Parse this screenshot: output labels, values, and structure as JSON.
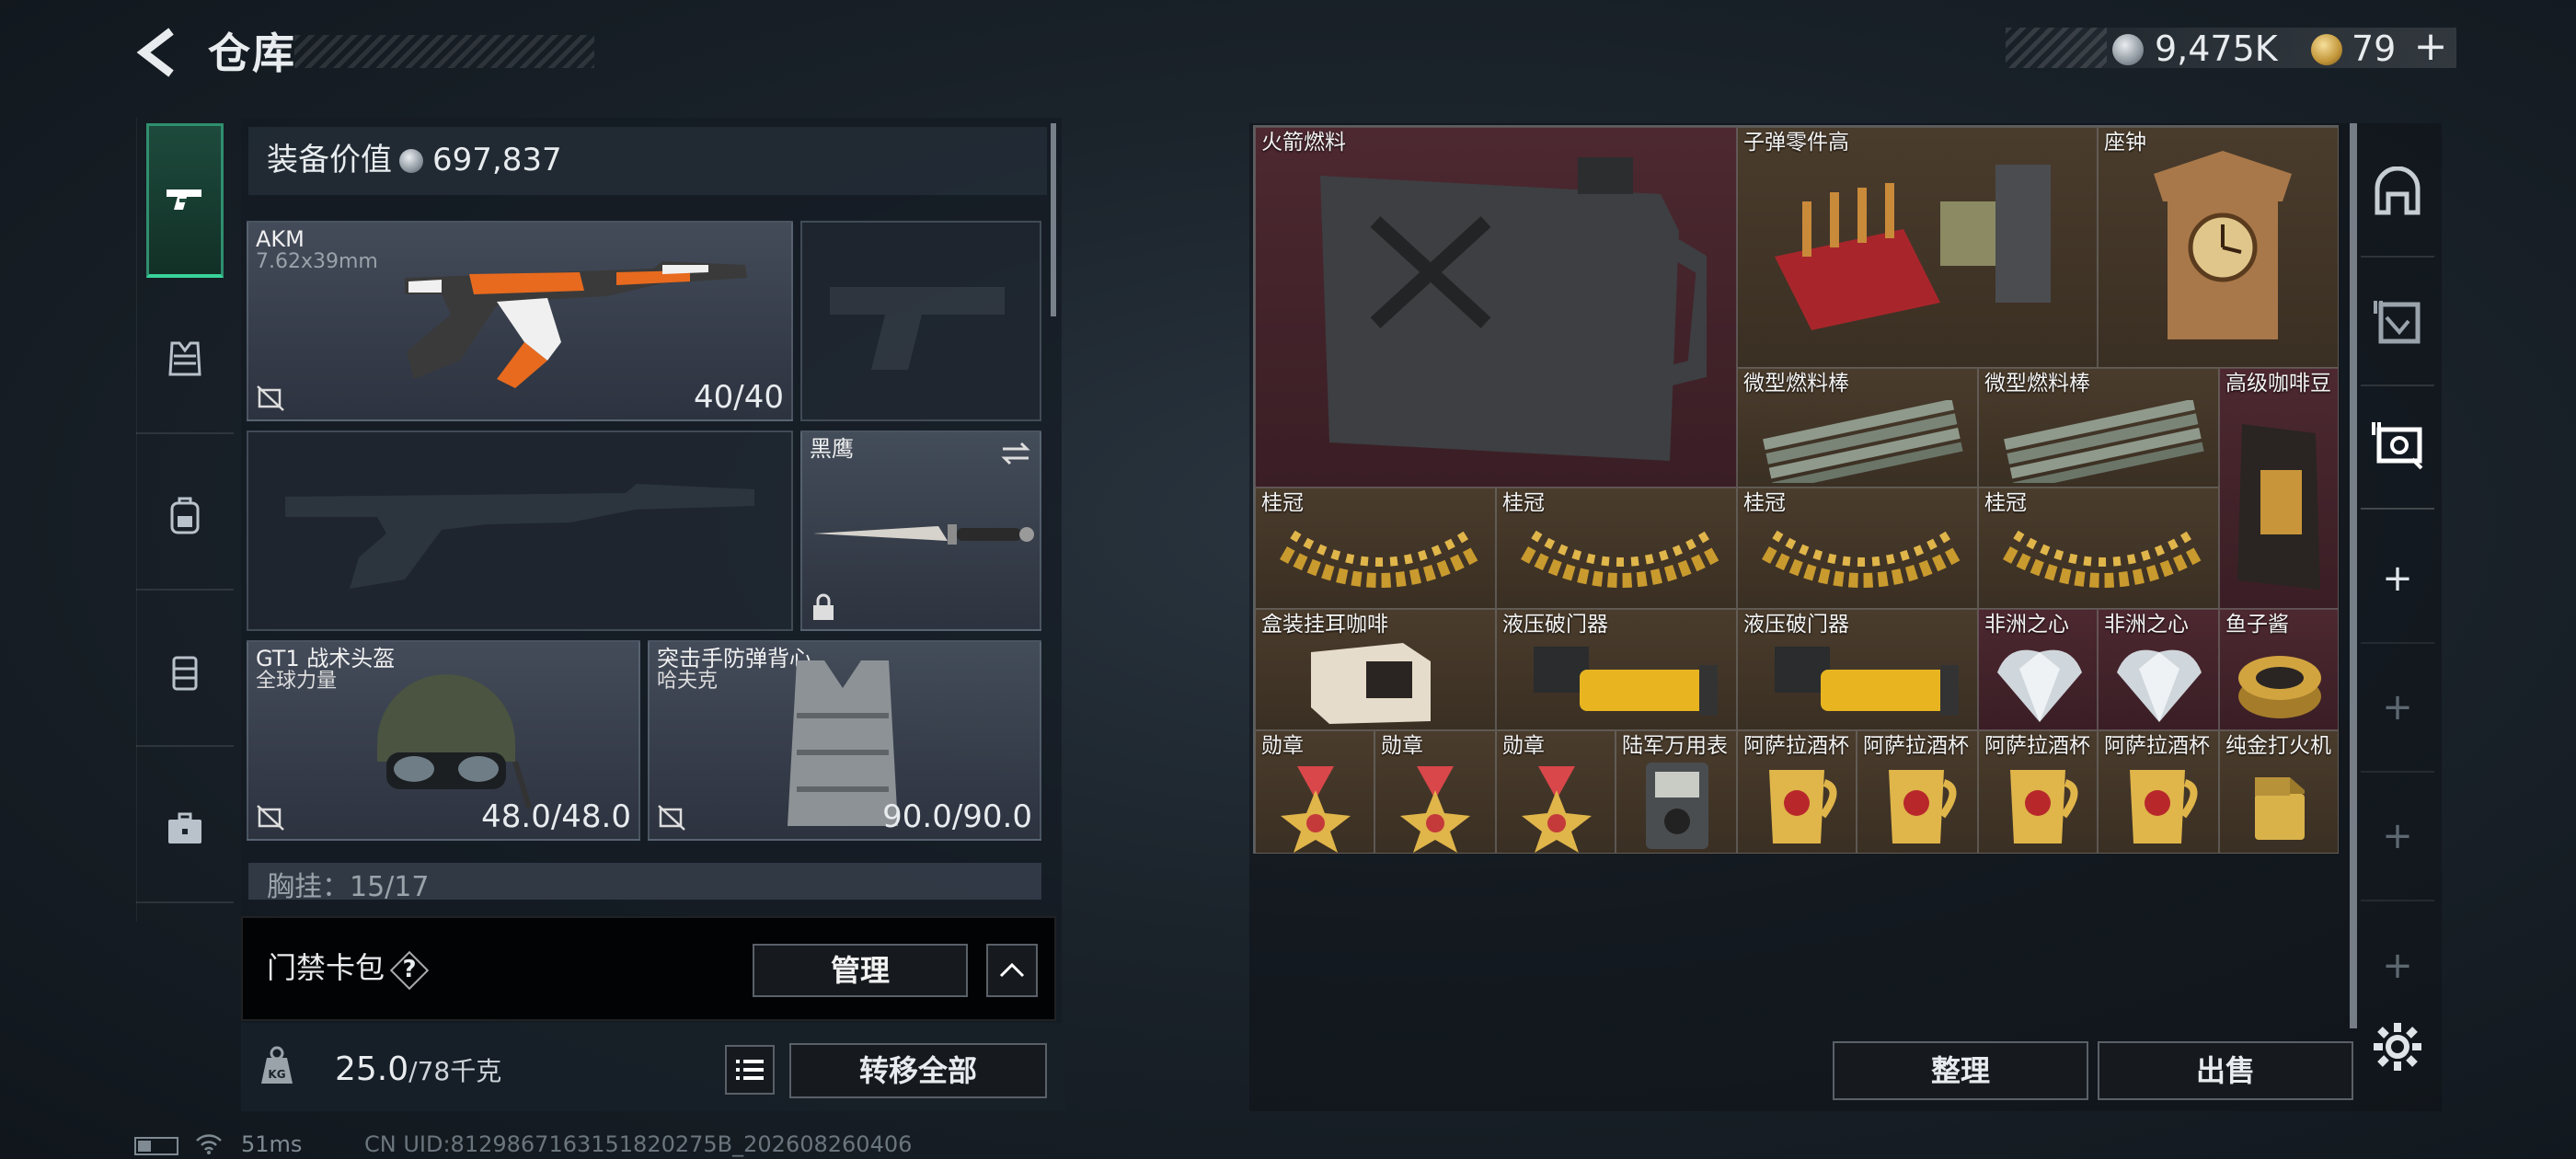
{
  "header": {
    "title": "仓库"
  },
  "currency": {
    "silver": "9,475K",
    "gold": "79"
  },
  "loadout": {
    "value_label": "装备价值",
    "value": "697,837",
    "primary": {
      "name": "AKM",
      "caliber": "7.62x39mm",
      "ammo": "40/40"
    },
    "melee": {
      "name": "黑鹰"
    },
    "helmet": {
      "name": "GT1 战术头盔",
      "brand": "全球力量",
      "durability": "48.0/48.0"
    },
    "armor": {
      "name": "突击手防弹背心",
      "brand": "哈夫克",
      "durability": "90.0/90.0"
    },
    "chest_rig": {
      "text": "胸挂：15/17"
    },
    "keycard": {
      "label": "门禁卡包",
      "help": "?",
      "manage": "管理"
    },
    "weight": {
      "current": "25.0",
      "max": "/78千克"
    },
    "transfer_all": "转移全部"
  },
  "stash": {
    "items": [
      {
        "name": "火箭燃料",
        "rarity": "red",
        "icon": "jerrycan-icon"
      },
      {
        "name": "子弹零件高",
        "rarity": "gold",
        "icon": "ammo-parts-icon"
      },
      {
        "name": "座钟",
        "rarity": "gold",
        "icon": "clock-icon"
      },
      {
        "name": "微型燃料棒",
        "rarity": "gold",
        "icon": "fuel-rod-icon"
      },
      {
        "name": "微型燃料棒",
        "rarity": "gold",
        "icon": "fuel-rod-icon"
      },
      {
        "name": "高级咖啡豆",
        "rarity": "red",
        "icon": "coffee-bag-icon"
      },
      {
        "name": "桂冠",
        "rarity": "gold",
        "icon": "laurel-icon"
      },
      {
        "name": "桂冠",
        "rarity": "gold",
        "icon": "laurel-icon"
      },
      {
        "name": "桂冠",
        "rarity": "gold",
        "icon": "laurel-icon"
      },
      {
        "name": "桂冠",
        "rarity": "gold",
        "icon": "laurel-icon"
      },
      {
        "name": "盒装挂耳咖啡",
        "rarity": "gold",
        "icon": "coffee-box-icon"
      },
      {
        "name": "液压破门器",
        "rarity": "gold",
        "icon": "breacher-icon"
      },
      {
        "name": "液压破门器",
        "rarity": "gold",
        "icon": "breacher-icon"
      },
      {
        "name": "非洲之心",
        "rarity": "red",
        "icon": "diamond-icon"
      },
      {
        "name": "非洲之心",
        "rarity": "red",
        "icon": "diamond-icon"
      },
      {
        "name": "鱼子酱",
        "rarity": "red",
        "icon": "caviar-icon"
      },
      {
        "name": "勋章",
        "rarity": "gold",
        "icon": "medal-icon"
      },
      {
        "name": "勋章",
        "rarity": "gold",
        "icon": "medal-icon"
      },
      {
        "name": "勋章",
        "rarity": "gold",
        "icon": "medal-icon"
      },
      {
        "name": "陆军万用表",
        "rarity": "gold",
        "icon": "multimeter-icon"
      },
      {
        "name": "阿萨拉酒杯",
        "rarity": "gold",
        "icon": "cup-icon"
      },
      {
        "name": "阿萨拉酒杯",
        "rarity": "gold",
        "icon": "cup-icon"
      },
      {
        "name": "阿萨拉酒杯",
        "rarity": "gold",
        "icon": "cup-icon"
      },
      {
        "name": "阿萨拉酒杯",
        "rarity": "gold",
        "icon": "cup-icon"
      },
      {
        "name": "纯金打火机",
        "rarity": "gold",
        "icon": "lighter-icon"
      }
    ],
    "sort": "整理",
    "sell": "出售"
  },
  "status": {
    "ping": "51ms",
    "uid": "CN UID:8129867163151820275B_202608260406"
  },
  "colors": {
    "accent_green": "#38d39a",
    "rarity_red": "#4d2830",
    "rarity_gold": "#4a3c2c"
  }
}
